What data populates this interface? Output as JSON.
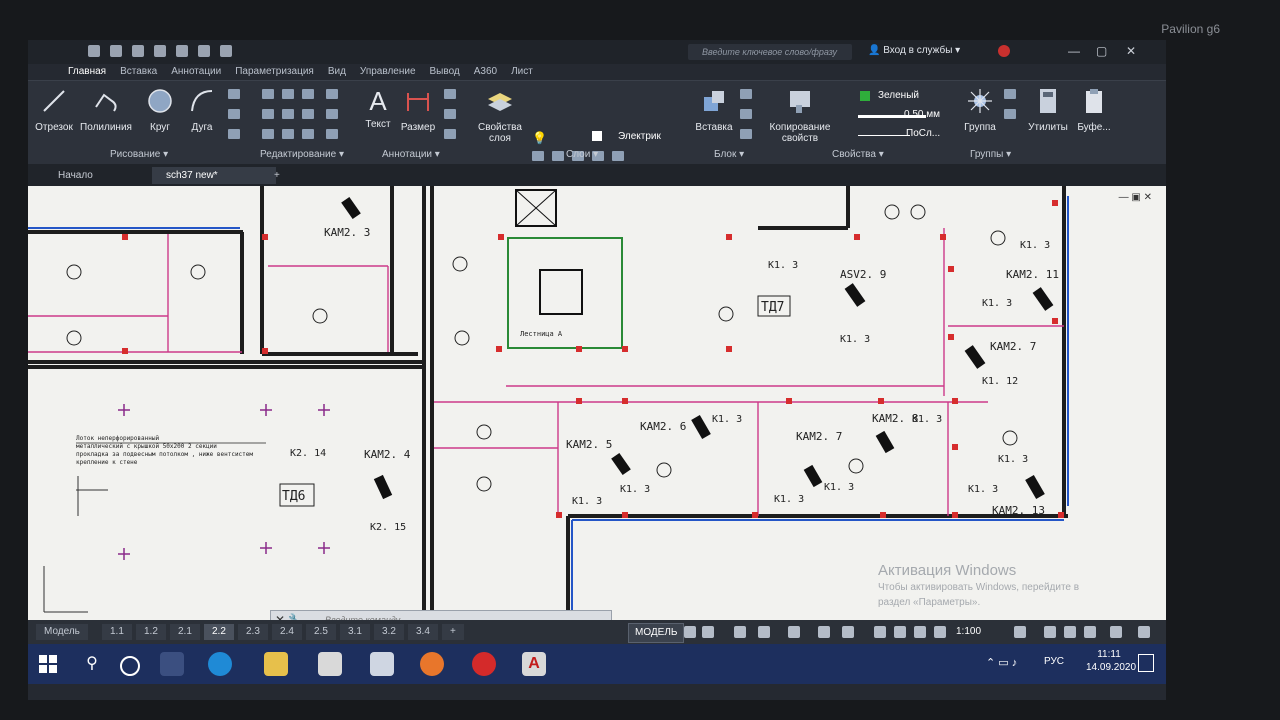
{
  "device": {
    "brand": "Pavilion g6"
  },
  "app": {
    "search_placeholder": "Введите ключевое слово/фразу",
    "signin_label": "Вход в службы",
    "tabs": [
      "Главная",
      "Вставка",
      "Аннотации",
      "Параметризация",
      "Вид",
      "Управление",
      "Вывод",
      "A360",
      "Лист"
    ]
  },
  "ribbon": {
    "draw": {
      "title": "Рисование",
      "tools": [
        "Отрезок",
        "Полилиния",
        "Круг",
        "Дуга"
      ]
    },
    "modify": {
      "title": "Редактирование"
    },
    "annotate": {
      "title": "Аннотации",
      "tools": [
        "Текст",
        "Размер"
      ]
    },
    "layers": {
      "title": "Слои",
      "props_label": "Свойства слоя",
      "current_layer": "Электрик"
    },
    "block": {
      "title": "Блок",
      "insert": "Вставка"
    },
    "props": {
      "title": "Свойства",
      "copy": "Копирование свойств",
      "color": "Зеленый",
      "lineweight": "0.50 мм",
      "linetype": "ПоСл..."
    },
    "groups": {
      "title": "Группы",
      "group": "Группа"
    },
    "utils": "Утилиты",
    "clipboard": "Буфе..."
  },
  "doc_tabs": [
    "Начало",
    "sch37 new*"
  ],
  "drawing": {
    "rooms": [
      {
        "id": "room-td7",
        "label": "ТД7"
      },
      {
        "id": "room-td6",
        "label": "ТД6"
      }
    ],
    "cameras": [
      "КАМ2. 3",
      "КАМ2. 4",
      "КАМ2. 5",
      "КАМ2. 6",
      "КАМ2. 7",
      "КАМ2. 7",
      "КАМ2. 8",
      "КАМ2. 11",
      "КАМ2. 13",
      "ASV2. 9"
    ],
    "cable_labels": [
      "K1. 3",
      "K1. 3",
      "K1. 3",
      "K1. 3",
      "K1. 3",
      "K1. 3",
      "K1. 3",
      "K1. 3",
      "K1. 3",
      "K1. 3",
      "K1. 3",
      "K1. 3",
      "K1. 12",
      "K2. 14",
      "K2. 15"
    ],
    "stair_label": "Лестница А",
    "note_lines": [
      "Лоток неперфорированный",
      "металлический с крышкой 50x200 2 секции",
      "прокладка за подвесным потолком , ниже вентсистем",
      "крепление к стене"
    ]
  },
  "watermark": {
    "title": "Активация Windows",
    "line1": "Чтобы активировать Windows, перейдите в",
    "line2": "раздел «Параметры»."
  },
  "command_prompt": "Введите команду",
  "layout_tabs": [
    "Модель",
    "1.1",
    "1.2",
    "2.1",
    "2.2",
    "2.3",
    "2.4",
    "2.5",
    "3.1",
    "3.2",
    "3.4"
  ],
  "active_layout": "2.2",
  "status": {
    "model": "МОДЕЛЬ",
    "scale": "1:100"
  },
  "tray": {
    "lang": "РУС",
    "time": "11:11",
    "date": "14.09.2020"
  }
}
